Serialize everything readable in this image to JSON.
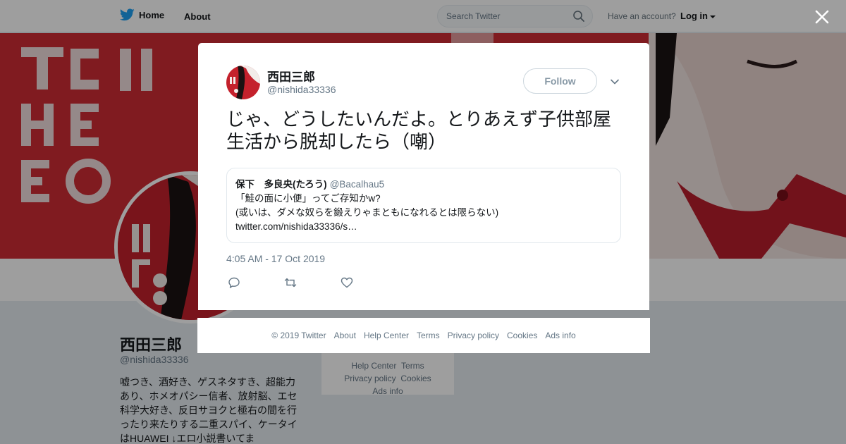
{
  "nav": {
    "home": "Home",
    "about": "About",
    "search_placeholder": "Search Twitter",
    "have_account": "Have an account?",
    "login": "Log in"
  },
  "profile": {
    "name": "西田三郎",
    "handle": "@nishida33336",
    "bio": "嘘つき、酒好き、ゲスネタすき、超能力あり、ホメオパシー信者、放射脳、エセ科学大好き、反日サヨクと極右の間を行ったり来たりする二重スパイ、ケータイはHUAWEI ↓エロ小説書いてま"
  },
  "profile_footer": {
    "help": "Help Center",
    "terms": "Terms",
    "privacy": "Privacy policy",
    "cookies": "Cookies",
    "ads": "Ads info"
  },
  "tweet": {
    "name": "西田三郎",
    "handle": "@nishida33336",
    "follow_label": "Follow",
    "text": "じゃ、どうしたいんだよ。とりあえず子供部屋生活から脱却したら（嘲）",
    "time": "4:05 AM - 17 Oct 2019",
    "quote": {
      "name": "保下　多良央(たろう)",
      "handle": "@Bacalhau5",
      "line1": "「鮭の面に小便」ってご存知かw?",
      "line2": "(或いは、ダメな奴らを鍛えりゃまともになれるとは限らない)",
      "line3": "twitter.com/nishida33336/s…"
    }
  },
  "footer": {
    "copyright": "© 2019 Twitter",
    "about": "About",
    "help": "Help Center",
    "terms": "Terms",
    "privacy": "Privacy policy",
    "cookies": "Cookies",
    "ads": "Ads info"
  },
  "colors": {
    "twitter_blue": "#1da1f2",
    "banner_red": "#cf2c35"
  }
}
